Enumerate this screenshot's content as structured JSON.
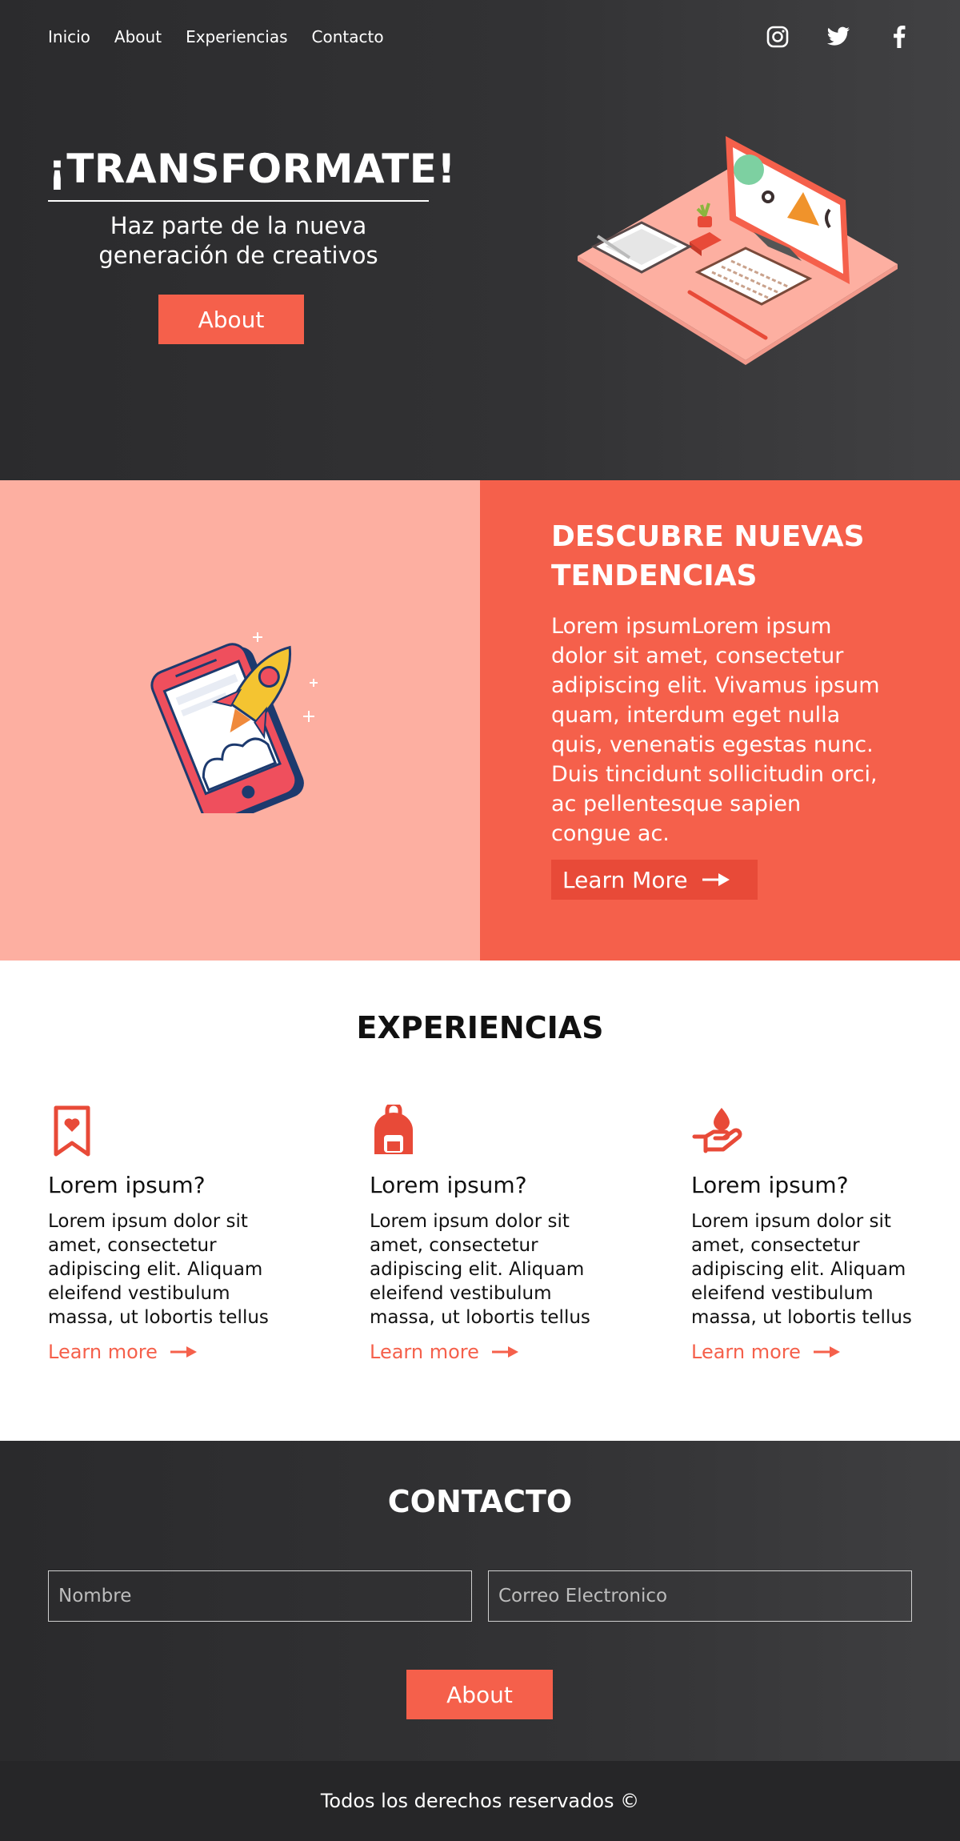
{
  "nav": {
    "items": [
      "Inicio",
      "About",
      "Experiencias",
      "Contacto"
    ]
  },
  "social": [
    "instagram-icon",
    "twitter-icon",
    "facebook-icon"
  ],
  "hero": {
    "title": "¡TRANSFORMATE!",
    "subtitle_line1": "Haz parte de la nueva",
    "subtitle_line2": "generación de creativos",
    "button": "About"
  },
  "trends": {
    "title_line1": "DESCUBRE NUEVAS",
    "title_line2": "TENDENCIAS",
    "body": "Lorem ipsumLorem ipsum dolor sit amet, consectetur adipiscing elit. Vivamus ipsum quam, interdum eget nulla quis, venenatis egestas nunc. Duis tincidunt sollicitudin orci, ac pellentesque sapien congue ac.",
    "button": "Learn More"
  },
  "experiences": {
    "title": "EXPERIENCIAS",
    "cards": [
      {
        "icon": "bookmark-heart-icon",
        "title": "Lorem ipsum?",
        "body": "Lorem ipsum dolor sit amet, consectetur adipiscing elit. Aliquam eleifend vestibulum massa, ut lobortis tellus",
        "link": "Learn more"
      },
      {
        "icon": "backpack-icon",
        "title": "Lorem ipsum?",
        "body": "Lorem ipsum dolor sit amet, consectetur adipiscing elit. Aliquam eleifend vestibulum massa, ut lobortis tellus",
        "link": "Learn more"
      },
      {
        "icon": "hand-drop-icon",
        "title": "Lorem ipsum?",
        "body": "Lorem ipsum dolor sit amet, consectetur adipiscing elit. Aliquam eleifend vestibulum massa, ut lobortis tellus",
        "link": "Learn more"
      }
    ]
  },
  "contact": {
    "title": "CONTACTO",
    "name_placeholder": "Nombre",
    "email_placeholder": "Correo Electronico",
    "button": "About"
  },
  "footer": {
    "text": "Todos los derechos reservados ©"
  },
  "colors": {
    "accent": "#f5604b",
    "pink": "#fdafa1",
    "dark": "#2b2b2d"
  }
}
